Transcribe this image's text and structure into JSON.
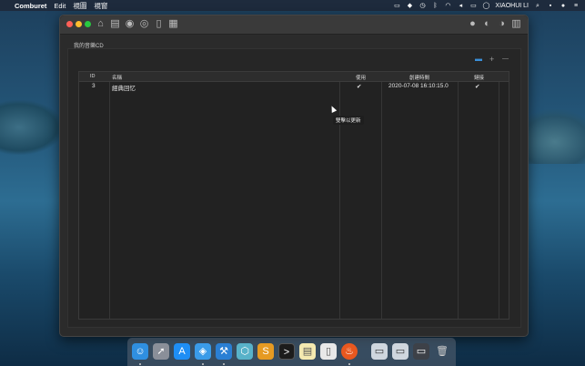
{
  "menubar": {
    "app_name": "Comburet",
    "menu_edit": "Edit",
    "menu_view1": "視圖",
    "menu_view2": "視窗",
    "user_name": "XIAOHUI LI"
  },
  "window": {
    "pane_label": "我的音樂CD",
    "toolbar_buttons": [
      "home-icon",
      "notes-icon",
      "disc-icon",
      "disc2-icon",
      "document-icon",
      "note-icon"
    ],
    "right_toolbar": [
      "person-icon",
      "settings-disc-icon",
      "sync-icon",
      "archive-icon"
    ],
    "panel_buttons": {
      "view_toggle": "▬",
      "add": "+",
      "remove": "—"
    }
  },
  "table": {
    "columns": [
      "ID",
      "名稱",
      "使用",
      "創建時間",
      "鏈接"
    ],
    "rows": [
      {
        "id": "3",
        "name": "經典回忆",
        "used": "✔",
        "created": "2020-07-08 16:10:15.0",
        "linked": "✔"
      }
    ]
  },
  "tooltip": {
    "text": "雙擊以更新"
  },
  "dock": {
    "items": [
      "finder",
      "launchpad",
      "app-store",
      "safari",
      "xcode",
      "sketch-like",
      "sublime",
      "terminal",
      "notes",
      "preview",
      "comburet",
      "window1",
      "window2",
      "window3",
      "trash"
    ]
  },
  "colors": {
    "accent": "#3a8fd8",
    "window_bg": "#2b2b2b",
    "table_bg": "#222222"
  }
}
